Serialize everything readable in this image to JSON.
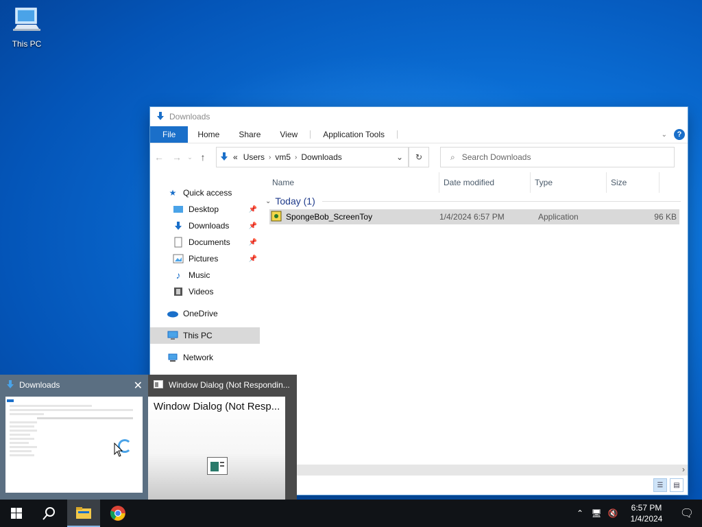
{
  "desktop": {
    "icon_label": "This PC"
  },
  "window": {
    "title": "Downloads",
    "ribbon": {
      "file": "File",
      "home": "Home",
      "share": "Share",
      "view": "View",
      "app_tools": "Application Tools"
    },
    "address": {
      "prefix": "«",
      "segments": [
        "Users",
        "vm5",
        "Downloads"
      ]
    },
    "search_placeholder": "Search Downloads",
    "sidebar": {
      "quick_access": "Quick access",
      "items": [
        "Desktop",
        "Downloads",
        "Documents",
        "Pictures",
        "Music",
        "Videos"
      ],
      "onedrive": "OneDrive",
      "this_pc": "This PC",
      "network": "Network"
    },
    "columns": [
      "Name",
      "Date modified",
      "Type",
      "Size"
    ],
    "group": "Today (1)",
    "files": [
      {
        "name": "SpongeBob_ScreenToy",
        "date": "1/4/2024 6:57 PM",
        "type": "Application",
        "size": "96 KB"
      }
    ]
  },
  "thumbnails": [
    {
      "title": "Downloads"
    },
    {
      "title": "Window Dialog (Not Respondin...",
      "content_title": "Window Dialog (Not Resp..."
    }
  ],
  "taskbar": {
    "time": "6:57 PM",
    "date": "1/4/2024"
  }
}
